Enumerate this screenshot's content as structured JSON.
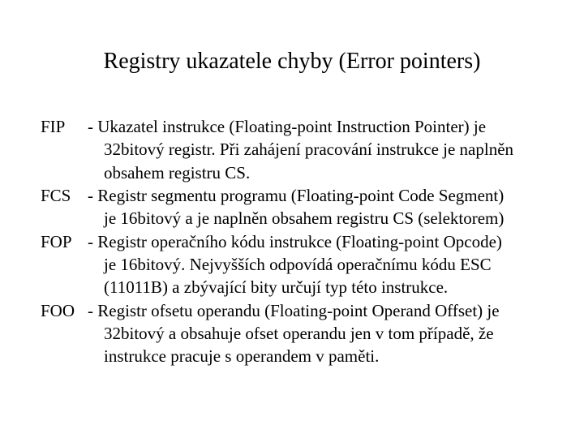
{
  "title": "Registry ukazatele chyby  (Error pointers)",
  "items": [
    {
      "name": "FIP",
      "line1": "- Ukazatel instrukce (Floating-point Instruction Pointer) je",
      "cont": [
        "32bitový registr. Při zahájení pracování instrukce je naplněn",
        "obsahem registru CS."
      ]
    },
    {
      "name": "FCS",
      "line1": "- Registr segmentu programu (Floating-point Code Segment)",
      "cont": [
        "je 16bitový a je naplněn obsahem registru CS (selektorem)"
      ]
    },
    {
      "name": "FOP",
      "line1": "- Registr operačního kódu instrukce (Floating-point Opcode)",
      "cont": [
        "je 16bitový. Nejvyšších odpovídá operačnímu kódu ESC",
        "(11011B) a zbývající bity určují typ této instrukce."
      ]
    },
    {
      "name": "FOO",
      "line1": "- Registr ofsetu operandu (Floating-point Operand Offset) je",
      "cont": [
        "32bitový a obsahuje ofset operandu jen v tom případě, že",
        "instrukce pracuje s operandem v paměti."
      ]
    }
  ]
}
